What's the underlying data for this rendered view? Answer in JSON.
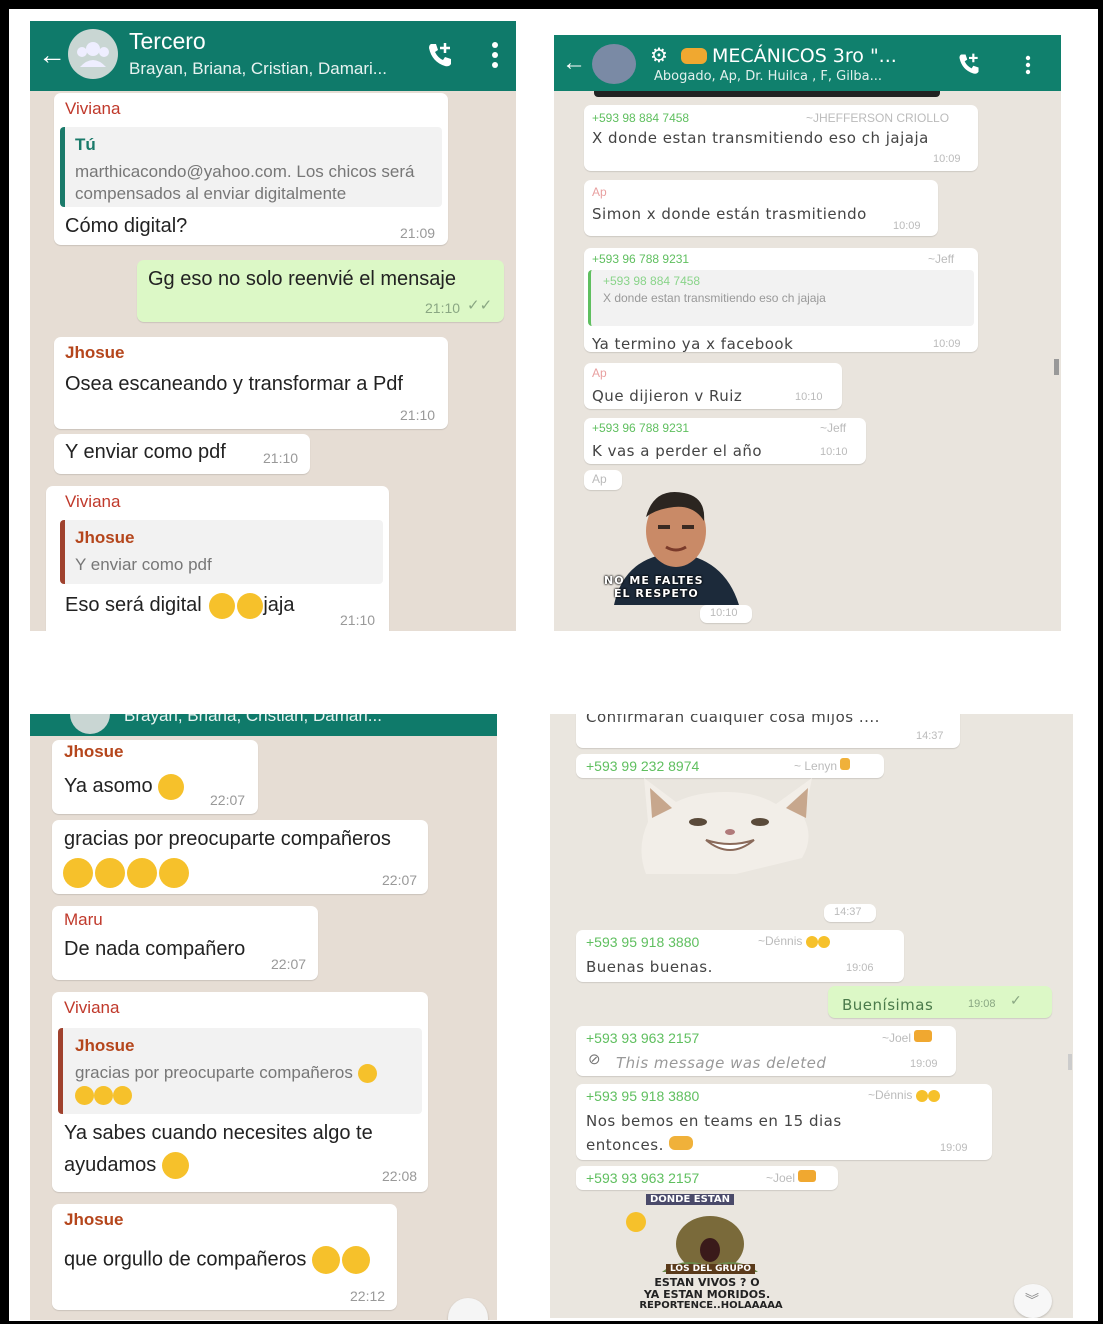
{
  "p1": {
    "header": {
      "title": "Tercero",
      "subtitle": "Brayan, Briana, Cristian, Damari..."
    },
    "m1": {
      "sender": "Viviana",
      "quote_name": "Tú",
      "quote_text": "marthicacondo@yahoo.com. Los chicos será  compensados al enviar digitalmente",
      "text": "Cómo digital?",
      "time": "21:09"
    },
    "m2": {
      "text": "Gg eso no solo reenvié  el mensaje",
      "time": "21:10"
    },
    "m3": {
      "sender": "Jhosue",
      "text": "Osea escaneando y transformar a Pdf",
      "time": "21:10"
    },
    "m4": {
      "text": "Y enviar como pdf",
      "time": "21:10"
    },
    "m5": {
      "sender": "Viviana",
      "quote_name": "Jhosue",
      "quote_text": "Y enviar como pdf",
      "text_a": "Eso será digital",
      "text_b": "jaja",
      "time": "21:10"
    }
  },
  "p2": {
    "header": {
      "title": "MECÁNICOS 3ro \"...",
      "subtitle": "Abogado, Ap, Dr. Huilca , F, Gilba..."
    },
    "m1": {
      "phone": "+593 98 884 7458",
      "name": "~JHEFFERSON CRIOLLO",
      "text": "X donde estan transmitiendo eso ch jajaja",
      "time": "10:09"
    },
    "m2": {
      "sender": "Ap",
      "text": "Simon x donde están trasmitiendo",
      "time": "10:09"
    },
    "m3": {
      "phone": "+593 96 788 9231",
      "name": "~Jeff",
      "quote_phone": "+593 98 884 7458",
      "quote_text": "X donde estan transmitiendo eso ch jajaja",
      "text": "Ya termino ya x facebook",
      "time": "10:09"
    },
    "m4": {
      "sender": "Ap",
      "text": "Que dijieron v Ruiz",
      "time": "10:10"
    },
    "m5": {
      "phone": "+593 96 788 9231",
      "name": "~Jeff",
      "text": "K vas a perder el año",
      "time": "10:10"
    },
    "m6": {
      "sender": "Ap",
      "sticker_text_1": "NO ME FALTES",
      "sticker_text_2": "EL RESPETO",
      "time": "10:10"
    }
  },
  "p3": {
    "header": {
      "subtitle": "Brayan, Briana, Cristian, Damari..."
    },
    "m1": {
      "sender": "Jhosue",
      "text": "Ya asomo",
      "time": "22:07"
    },
    "m2": {
      "text": "gracias por preocuparte compañeros",
      "time": "22:07"
    },
    "m3": {
      "sender": "Maru",
      "text": "De nada compañero",
      "time": "22:07"
    },
    "m4": {
      "sender": "Viviana",
      "quote_name": "Jhosue",
      "quote_text": "gracias por preocuparte compañeros",
      "text_a": "Ya sabes cuando necesites algo te",
      "text_b": "ayudamos",
      "time": "22:08"
    },
    "m5": {
      "sender": "Jhosue",
      "text": "que orgullo de compañeros",
      "time": "22:12"
    }
  },
  "p4": {
    "m0": {
      "text": "Confirmaran cualquier cosa mijos ....",
      "time": "14:37"
    },
    "m1": {
      "phone": "+593 99 232 8974",
      "name": "~ Lenyn",
      "time": "14:37"
    },
    "m2": {
      "phone": "+593 95 918 3880",
      "name": "~Dénnis",
      "text": "Buenas buenas.",
      "time": "19:06"
    },
    "m3": {
      "text": "Buenísimas",
      "time": "19:08"
    },
    "m4": {
      "phone": "+593 93 963 2157",
      "name": "~Joel",
      "text": "This message was deleted",
      "time": "19:09"
    },
    "m5": {
      "phone": "+593 95 918 3880",
      "name": "~Dénnis",
      "text_a": "Nos bemos en teams en 15 dias",
      "text_b": "entonces.",
      "time": "19:09"
    },
    "m6": {
      "phone": "+593 93 963 2157",
      "name": "~Joel",
      "sticker_lines": [
        "DONDE ESTAN",
        "LOS DEL GRUPO",
        "ESTAN VIVOS ? O",
        "YA ESTAN MORIDOS.",
        "REPORTENCE..HOLAAAAA"
      ]
    }
  },
  "colors": {
    "header": "#0f7a6a",
    "chat_bg": "#e6ddd4",
    "out_bubble": "#dcf8c6",
    "viviana": "#c0392b",
    "jhosue": "#b5461c",
    "phone": "#5fbf5f"
  }
}
